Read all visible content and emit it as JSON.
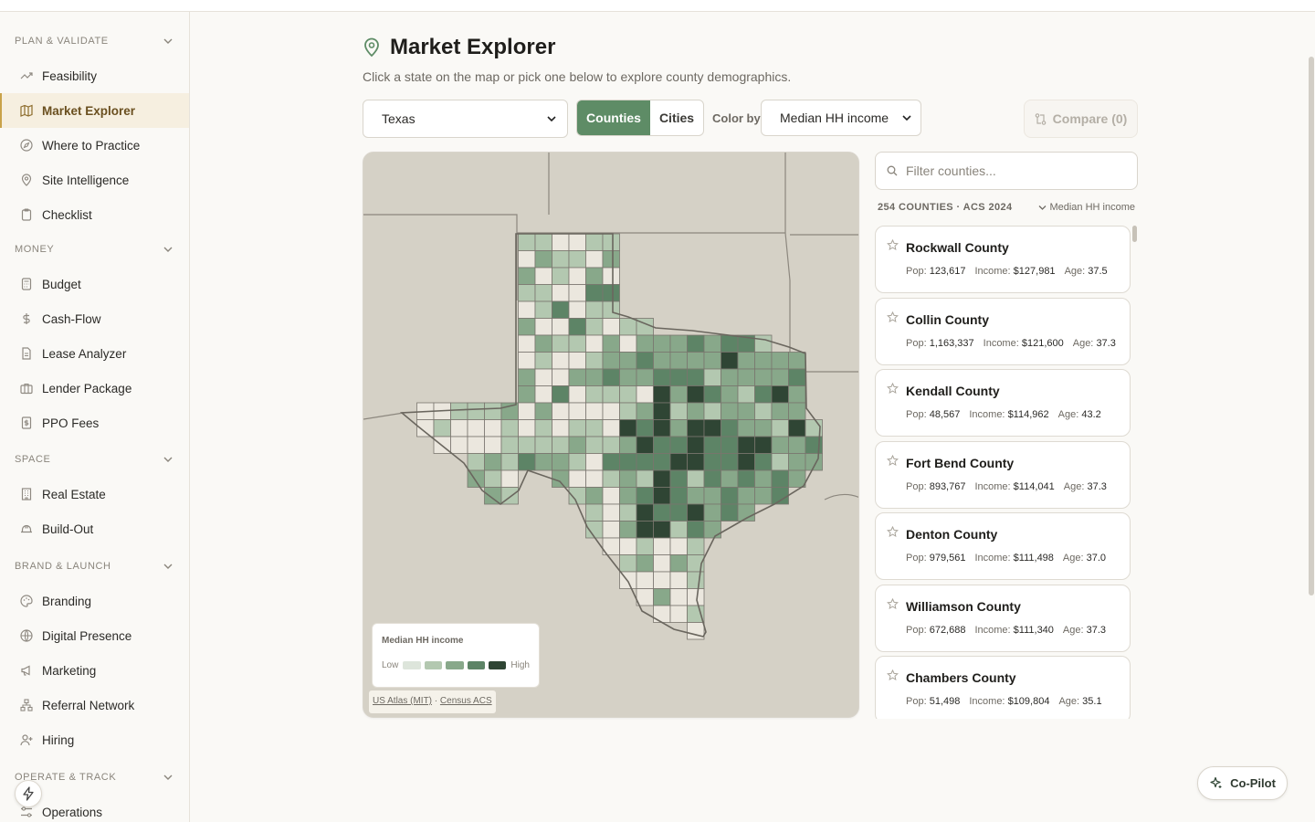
{
  "sidebar": {
    "sections": [
      {
        "title": "PLAN & VALIDATE",
        "items": [
          {
            "label": "Feasibility",
            "icon": "trend-icon"
          },
          {
            "label": "Market Explorer",
            "icon": "map-icon",
            "active": true
          },
          {
            "label": "Where to Practice",
            "icon": "compass-icon"
          },
          {
            "label": "Site Intelligence",
            "icon": "pin-icon"
          },
          {
            "label": "Checklist",
            "icon": "clipboard-icon"
          }
        ]
      },
      {
        "title": "MONEY",
        "items": [
          {
            "label": "Budget",
            "icon": "calculator-icon"
          },
          {
            "label": "Cash-Flow",
            "icon": "dollar-icon"
          },
          {
            "label": "Lease Analyzer",
            "icon": "document-icon"
          },
          {
            "label": "Lender Package",
            "icon": "briefcase-icon"
          },
          {
            "label": "PPO Fees",
            "icon": "receipt-icon"
          }
        ]
      },
      {
        "title": "SPACE",
        "items": [
          {
            "label": "Real Estate",
            "icon": "building-icon"
          },
          {
            "label": "Build-Out",
            "icon": "hardhat-icon"
          }
        ]
      },
      {
        "title": "BRAND & LAUNCH",
        "items": [
          {
            "label": "Branding",
            "icon": "palette-icon"
          },
          {
            "label": "Digital Presence",
            "icon": "globe-icon"
          },
          {
            "label": "Marketing",
            "icon": "megaphone-icon"
          },
          {
            "label": "Referral Network",
            "icon": "network-icon"
          },
          {
            "label": "Hiring",
            "icon": "user-plus-icon"
          }
        ]
      },
      {
        "title": "OPERATE & TRACK",
        "items": [
          {
            "label": "Operations",
            "icon": "sliders-icon"
          }
        ]
      }
    ]
  },
  "header": {
    "title": "Market Explorer",
    "subtitle": "Click a state on the map or pick one below to explore county demographics."
  },
  "controls": {
    "state": "Texas",
    "mode_on": "Counties",
    "mode_off": "Cities",
    "color_by_label": "Color by",
    "color_by_value": "Median HH income",
    "compare_label": "Compare (0)"
  },
  "map": {
    "legend_title": "Median HH income",
    "legend_low": "Low",
    "legend_high": "High",
    "legend_colors": [
      "#dde5db",
      "#b3c8b0",
      "#88a88a",
      "#5d8466",
      "#2f4534"
    ],
    "attrib_1": "US Atlas (MIT)",
    "attrib_sep": "·",
    "attrib_2": "Census ACS"
  },
  "list": {
    "filter_placeholder": "Filter counties...",
    "count_label": "254 COUNTIES · ACS 2024",
    "sort_label": "Median HH income",
    "pop_label": "Pop:",
    "income_label": "Income:",
    "age_label": "Age:",
    "counties": [
      {
        "name": "Rockwall County",
        "pop": "123,617",
        "income": "$127,981",
        "age": "37.5"
      },
      {
        "name": "Collin County",
        "pop": "1,163,337",
        "income": "$121,600",
        "age": "37.3"
      },
      {
        "name": "Kendall County",
        "pop": "48,567",
        "income": "$114,962",
        "age": "43.2"
      },
      {
        "name": "Fort Bend County",
        "pop": "893,767",
        "income": "$114,041",
        "age": "37.3"
      },
      {
        "name": "Denton County",
        "pop": "979,561",
        "income": "$111,498",
        "age": "37.0"
      },
      {
        "name": "Williamson County",
        "pop": "672,688",
        "income": "$111,340",
        "age": "37.3"
      },
      {
        "name": "Chambers County",
        "pop": "51,498",
        "income": "$109,804",
        "age": "35.1"
      }
    ]
  },
  "copilot": {
    "label": "Co-Pilot"
  }
}
